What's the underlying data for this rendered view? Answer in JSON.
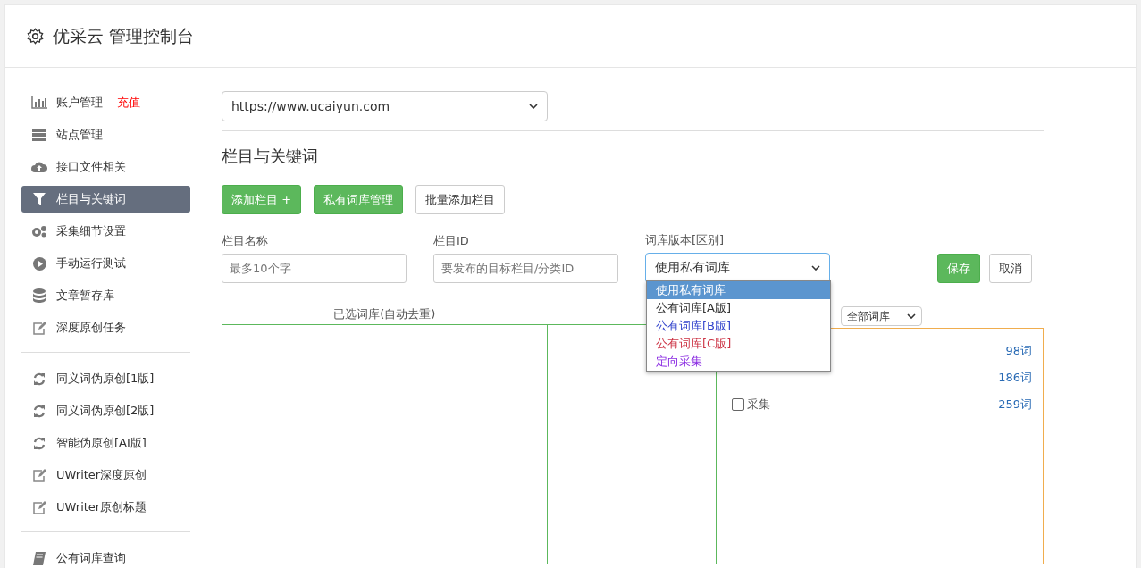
{
  "header": {
    "title": "优采云 管理控制台"
  },
  "sidebar": {
    "groups": [
      [
        {
          "label": "账户管理",
          "badge": "充值",
          "selected": false
        },
        {
          "label": "站点管理",
          "selected": false
        },
        {
          "label": "接口文件相关",
          "selected": false
        },
        {
          "label": "栏目与关键词",
          "selected": true
        },
        {
          "label": "采集细节设置",
          "selected": false
        },
        {
          "label": "手动运行测试",
          "selected": false
        },
        {
          "label": "文章暂存库",
          "selected": false
        },
        {
          "label": "深度原创任务",
          "selected": false
        }
      ],
      [
        {
          "label": "同义词伪原创[1版]",
          "selected": false
        },
        {
          "label": "同义词伪原创[2版]",
          "selected": false
        },
        {
          "label": "智能伪原创[AI版]",
          "selected": false
        },
        {
          "label": "UWriter深度原创",
          "selected": false
        },
        {
          "label": "UWriter原创标题",
          "selected": false
        }
      ],
      [
        {
          "label": "公有词库查询",
          "selected": false
        }
      ]
    ]
  },
  "site_select": {
    "value": "https://www.ucaiyun.com"
  },
  "section_title": "栏目与关键词",
  "toolbar": [
    {
      "label": "添加栏目 +",
      "kind": "primary"
    },
    {
      "label": "私有词库管理",
      "kind": "primary"
    },
    {
      "label": "批量添加栏目",
      "kind": "default"
    }
  ],
  "form": {
    "fields": [
      {
        "label": "栏目名称",
        "placeholder": "最多10个字",
        "kind": "input"
      },
      {
        "label": "栏目ID",
        "placeholder": "要发布的目标栏目/分类ID",
        "kind": "input"
      },
      {
        "label": "词库版本[区别]",
        "value": "使用私有词库",
        "kind": "select"
      }
    ],
    "buttons": [
      {
        "label": "保存",
        "kind": "primary"
      },
      {
        "label": "取消",
        "kind": "default"
      }
    ]
  },
  "dropdown": {
    "options": [
      {
        "label": "使用私有词库",
        "selected": true
      },
      {
        "label": "公有词库[A版]",
        "selected": false,
        "color": "#333333"
      },
      {
        "label": "公有词库[B版]",
        "selected": false,
        "color": "#3344cc"
      },
      {
        "label": "公有词库[C版]",
        "selected": false,
        "color": "#cc3344"
      },
      {
        "label": "定向采集",
        "selected": false,
        "color": "#8a2be2"
      }
    ]
  },
  "selected_panel": {
    "title": "已选词库(自动去重)"
  },
  "library_panel": {
    "filter": "全部词库",
    "rows": [
      {
        "count": "98词"
      },
      {
        "count": "186词"
      },
      {
        "label": "采集",
        "count": "259词",
        "checked": false
      }
    ]
  }
}
